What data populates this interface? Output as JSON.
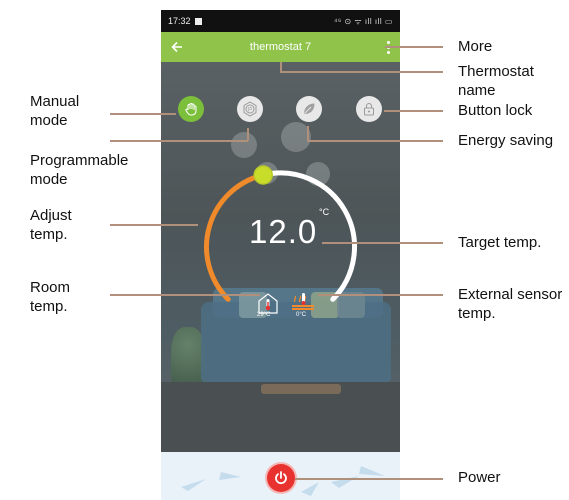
{
  "status_bar": {
    "time": "17:32",
    "icons": "⁴⁶ ⊙ ᯤ ıll ıll ▭"
  },
  "app_bar": {
    "title": "thermostat 7",
    "back_icon": "arrow-left-icon",
    "more_icon": "vertical-dots-icon"
  },
  "modes": [
    {
      "name": "manual-mode",
      "icon": "hand-icon",
      "active": true
    },
    {
      "name": "programmable-mode",
      "icon": "program-p-icon",
      "active": false
    },
    {
      "name": "energy-saving",
      "icon": "leaf-icon",
      "active": false
    },
    {
      "name": "button-lock",
      "icon": "lock-icon",
      "active": false
    }
  ],
  "thermostat": {
    "target_temp": "12.0",
    "unit": "°C",
    "room_temp": "29°C",
    "external_temp": "0°C",
    "setpoint_fraction": 0.45,
    "arc_color_active": "#f08a2a",
    "arc_color_track": "#ffffff",
    "knob_color": "#c8dc2a"
  },
  "annotations": {
    "more": "More",
    "thermostat_name": "Thermostat\nname",
    "button_lock": "Button lock",
    "energy_saving": "Energy saving",
    "target_temp": "Target temp.",
    "external_sensor": "External sensor\ntemp.",
    "power": "Power",
    "manual_mode": "Manual\nmode",
    "programmable_mode": "Programmable\nmode",
    "adjust_temp": "Adjust\ntemp.",
    "room_temp": "Room\ntemp."
  },
  "colors": {
    "app_bar": "#8fc34a",
    "power": "#e8322f",
    "annotation_line": "#b0907a"
  }
}
